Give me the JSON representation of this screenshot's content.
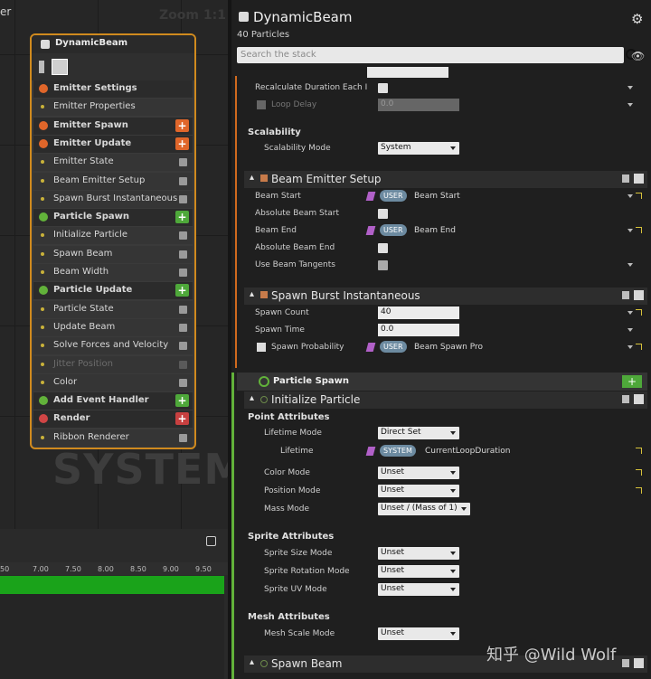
{
  "graph": {
    "title_fragment": "er",
    "zoom": "Zoom 1:1",
    "system_watermark": "SYSTEM",
    "node": {
      "title": "DynamicBeam",
      "rows": [
        {
          "label": "Emitter Settings",
          "kind": "sec",
          "color": "#e0662a"
        },
        {
          "label": "Emitter Properties",
          "kind": "mod",
          "icon": "cpu-icon"
        },
        {
          "label": "Emitter Spawn",
          "kind": "sec",
          "color": "#e0662a",
          "add": "#e0662a"
        },
        {
          "label": "Emitter Update",
          "kind": "sec",
          "color": "#e0662a",
          "add": "#e0662a"
        },
        {
          "label": "Emitter State",
          "kind": "mod",
          "check": true
        },
        {
          "label": "Beam Emitter Setup",
          "kind": "mod",
          "check": true
        },
        {
          "label": "Spawn Burst Instantaneous",
          "kind": "mod",
          "check": true
        },
        {
          "label": "Particle Spawn",
          "kind": "sec",
          "color": "#62b23a",
          "add": "#4ea83a"
        },
        {
          "label": "Initialize Particle",
          "kind": "mod",
          "check": true
        },
        {
          "label": "Spawn Beam",
          "kind": "mod",
          "check": true
        },
        {
          "label": "Beam Width",
          "kind": "mod",
          "check": true
        },
        {
          "label": "Particle Update",
          "kind": "sec",
          "color": "#62b23a",
          "add": "#4ea83a"
        },
        {
          "label": "Particle State",
          "kind": "mod",
          "check": true
        },
        {
          "label": "Update Beam",
          "kind": "mod",
          "check": true
        },
        {
          "label": "Solve Forces and Velocity",
          "kind": "mod",
          "check": true
        },
        {
          "label": "Jitter Position",
          "kind": "mod",
          "check": true,
          "disabled": true
        },
        {
          "label": "Color",
          "kind": "mod",
          "check": true
        },
        {
          "label": "Add Event Handler",
          "kind": "sec",
          "color": "#62b23a",
          "add": "#4ea83a"
        },
        {
          "label": "Render",
          "kind": "sec",
          "color": "#d04545",
          "add": "#c84040"
        },
        {
          "label": "Ribbon Renderer",
          "kind": "mod",
          "check": true
        }
      ]
    },
    "timeline_ticks": [
      "50",
      "7.00",
      "7.50",
      "8.00",
      "8.50",
      "9.00",
      "9.50"
    ]
  },
  "panel": {
    "title": "DynamicBeam",
    "subtitle": "40 Particles",
    "search_placeholder": "Search the stack",
    "emitter_props": {
      "recalc_label": "Recalculate Duration Each I",
      "loop_delay_label": "Loop Delay",
      "loop_delay_value": "0.0"
    },
    "scalability": {
      "category": "Scalability",
      "mode_label": "Scalability Mode",
      "mode_value": "System"
    },
    "beam_setup": {
      "title": "Beam Emitter Setup",
      "beam_start_label": "Beam Start",
      "beam_start_ns": "USER",
      "beam_start_value": "Beam Start",
      "abs_start_label": "Absolute Beam Start",
      "beam_end_label": "Beam End",
      "beam_end_ns": "USER",
      "beam_end_value": "Beam End",
      "abs_end_label": "Absolute Beam End",
      "tangents_label": "Use Beam Tangents"
    },
    "spawn_burst": {
      "title": "Spawn Burst Instantaneous",
      "count_label": "Spawn Count",
      "count_value": "40",
      "time_label": "Spawn Time",
      "time_value": "0.0",
      "prob_label": "Spawn Probability",
      "prob_ns": "USER",
      "prob_value": "Beam Spawn Pro"
    },
    "particle_spawn_label": "Particle Spawn",
    "init_particle": {
      "title": "Initialize Particle",
      "point_cat": "Point Attributes",
      "lifetime_mode_label": "Lifetime Mode",
      "lifetime_mode_value": "Direct Set",
      "lifetime_label": "Lifetime",
      "lifetime_ns": "SYSTEM",
      "lifetime_value": "CurrentLoopDuration",
      "color_mode_label": "Color Mode",
      "color_mode_value": "Unset",
      "position_mode_label": "Position Mode",
      "position_mode_value": "Unset",
      "mass_mode_label": "Mass Mode",
      "mass_mode_value": "Unset / (Mass of 1)",
      "sprite_cat": "Sprite Attributes",
      "sprite_size_label": "Sprite Size Mode",
      "sprite_size_value": "Unset",
      "sprite_rot_label": "Sprite Rotation Mode",
      "sprite_rot_value": "Unset",
      "sprite_uv_label": "Sprite UV Mode",
      "sprite_uv_value": "Unset",
      "mesh_cat": "Mesh Attributes",
      "mesh_scale_label": "Mesh Scale Mode",
      "mesh_scale_value": "Unset"
    },
    "spawn_beam_title": "Spawn Beam"
  },
  "watermark": "知乎 @Wild Wolf"
}
